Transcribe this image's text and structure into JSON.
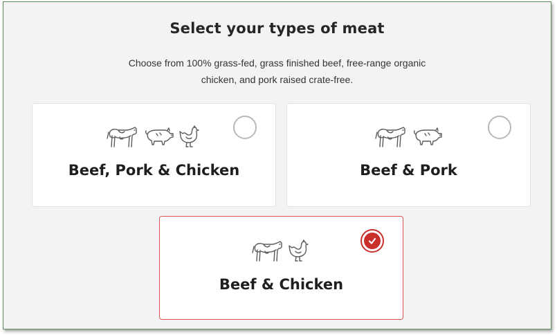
{
  "header": {
    "title": "Select your types of meat",
    "subtitle_line1": "Choose from 100% grass-fed, grass finished beef, free-range organic",
    "subtitle_line2": "chicken, and pork raised crate-free."
  },
  "options": [
    {
      "label": "Beef, Pork & Chicken",
      "icons": [
        "cow-icon",
        "pig-icon",
        "chicken-icon"
      ],
      "selected": false
    },
    {
      "label": "Beef & Pork",
      "icons": [
        "cow-icon",
        "pig-icon"
      ],
      "selected": false
    },
    {
      "label": "Beef & Chicken",
      "icons": [
        "cow-icon",
        "chicken-icon"
      ],
      "selected": true
    }
  ],
  "colors": {
    "accent": "#c9302c",
    "selected_border": "#d9534f",
    "background": "#f3f3f3",
    "card": "#ffffff"
  }
}
